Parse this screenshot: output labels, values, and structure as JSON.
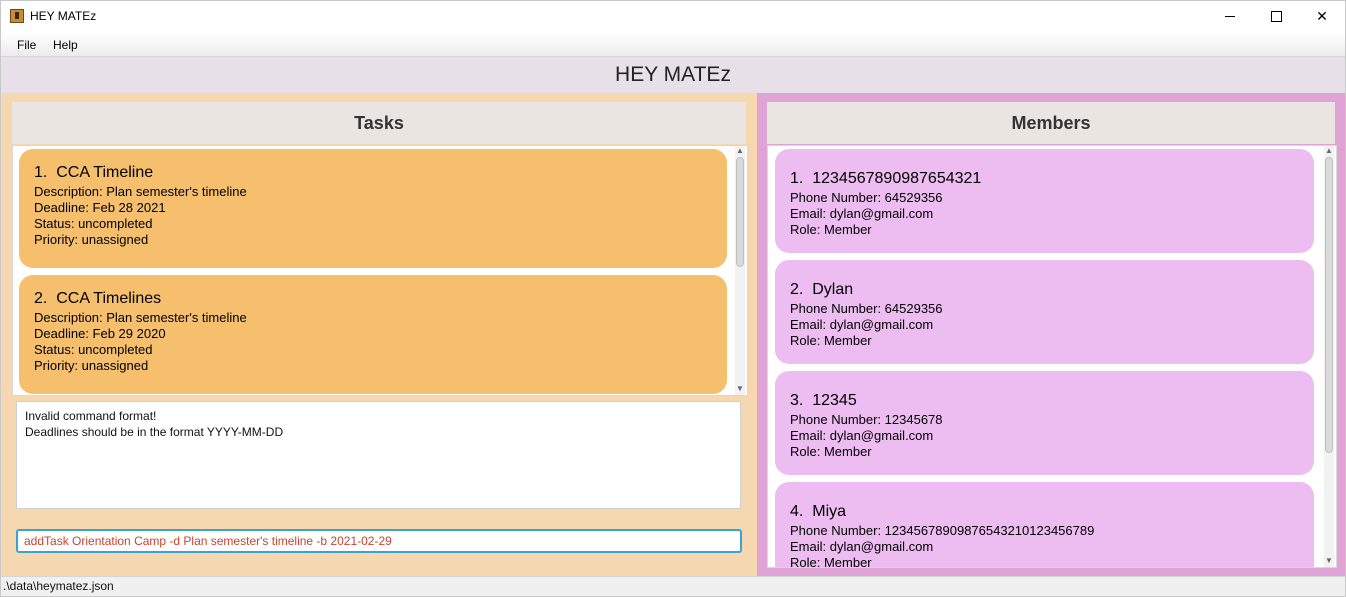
{
  "window": {
    "title": "HEY MATEz"
  },
  "menu": {
    "file": "File",
    "help": "Help"
  },
  "header": {
    "title": "HEY MATEz"
  },
  "tasks": {
    "heading": "Tasks",
    "items": [
      {
        "index": "1.",
        "name": "CCA Timeline",
        "description": "Description: Plan semester's timeline",
        "deadline": "Deadline: Feb 28 2021",
        "status": "Status: uncompleted",
        "priority": "Priority: unassigned"
      },
      {
        "index": "2.",
        "name": "CCA Timelines",
        "description": "Description: Plan semester's timeline",
        "deadline": "Deadline: Feb 29 2020",
        "status": "Status: uncompleted",
        "priority": "Priority: unassigned"
      }
    ]
  },
  "result": {
    "line1": "Invalid command format!",
    "line2": "Deadlines should be in the format YYYY-MM-DD"
  },
  "command": {
    "value": "addTask Orientation Camp -d Plan semester's timeline -b 2021-02-29"
  },
  "members": {
    "heading": "Members",
    "items": [
      {
        "index": "1.",
        "name": "1234567890987654321",
        "phone": "Phone Number: 64529356",
        "email": "Email: dylan@gmail.com",
        "role": "Role: Member"
      },
      {
        "index": "2.",
        "name": "Dylan",
        "phone": "Phone Number: 64529356",
        "email": "Email: dylan@gmail.com",
        "role": "Role: Member"
      },
      {
        "index": "3.",
        "name": "12345",
        "phone": "Phone Number: 12345678",
        "email": "Email: dylan@gmail.com",
        "role": "Role: Member"
      },
      {
        "index": "4.",
        "name": "Miya",
        "phone": "Phone Number: 12345678909876543210123456789",
        "email": "Email: dylan@gmail.com",
        "role": "Role: Member"
      }
    ]
  },
  "status": {
    "path": ".\\data\\heymatez.json"
  },
  "colors": {
    "task_card": "#f5bf6e",
    "member_card": "#edbcf0",
    "left_panel": "#f5d7b0",
    "right_panel": "#dfa3d6",
    "command_text": "#c8442e"
  }
}
